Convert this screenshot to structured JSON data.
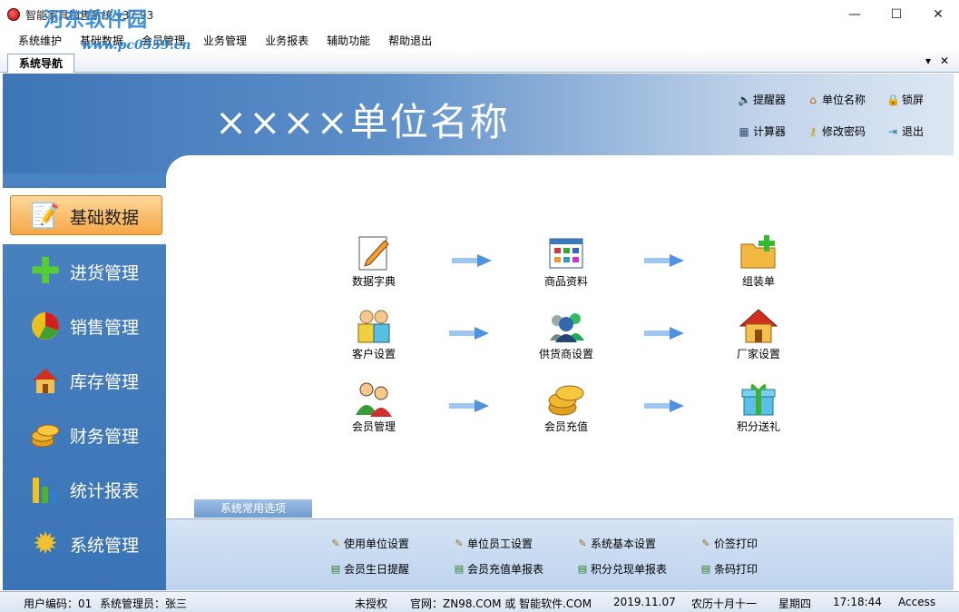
{
  "window": {
    "title": "智能家具销售系统 v37.93",
    "watermark": "河东软件园",
    "watermark_url": "www.pc0359.cn",
    "controls": {
      "minimize": "—",
      "maximize": "☐",
      "close": "✕"
    }
  },
  "menu": [
    "系统维护",
    "基础数据",
    "会员管理",
    "业务管理",
    "业务报表",
    "辅助功能",
    "帮助退出"
  ],
  "tabs": {
    "active": "系统导航",
    "dropdown": "▾",
    "close": "✕"
  },
  "header": {
    "unit_name": "××××单位名称",
    "tools": [
      {
        "label": "提醒器",
        "icon": "speaker-icon"
      },
      {
        "label": "单位名称",
        "icon": "home-icon"
      },
      {
        "label": "锁屏",
        "icon": "lock-icon"
      },
      {
        "label": "计算器",
        "icon": "calculator-icon"
      },
      {
        "label": "修改密码",
        "icon": "key-icon"
      },
      {
        "label": "退出",
        "icon": "exit-icon"
      }
    ]
  },
  "sidebar": {
    "items": [
      {
        "label": "基础数据",
        "icon": "pencil-icon",
        "active": true
      },
      {
        "label": "进货管理",
        "icon": "plus-icon"
      },
      {
        "label": "销售管理",
        "icon": "pie-chart-icon"
      },
      {
        "label": "库存管理",
        "icon": "house-icon"
      },
      {
        "label": "财务管理",
        "icon": "coins-icon"
      },
      {
        "label": "统计报表",
        "icon": "bar-chart-icon"
      },
      {
        "label": "系统管理",
        "icon": "gear-icon"
      }
    ]
  },
  "flow": {
    "rows": [
      [
        {
          "label": "数据字典",
          "icon": "notepad-icon"
        },
        {
          "label": "商品资料",
          "icon": "grid-window-icon"
        },
        {
          "label": "组装单",
          "icon": "folder-add-icon"
        }
      ],
      [
        {
          "label": "客户设置",
          "icon": "users-icon"
        },
        {
          "label": "供货商设置",
          "icon": "group-icon"
        },
        {
          "label": "厂家设置",
          "icon": "house-icon"
        }
      ],
      [
        {
          "label": "会员管理",
          "icon": "members-icon"
        },
        {
          "label": "会员充值",
          "icon": "coins-icon"
        },
        {
          "label": "积分送礼",
          "icon": "gift-icon"
        }
      ]
    ]
  },
  "common": {
    "title": "系统常用选项",
    "options": [
      {
        "label": "使用单位设置",
        "icon": "settings-doc-icon"
      },
      {
        "label": "单位员工设置",
        "icon": "settings-doc-icon"
      },
      {
        "label": "系统基本设置",
        "icon": "settings-doc-icon"
      },
      {
        "label": "价签打印",
        "icon": "settings-doc-icon"
      },
      {
        "label": "会员生日提醒",
        "icon": "report-icon"
      },
      {
        "label": "会员充值单报表",
        "icon": "report-icon"
      },
      {
        "label": "积分兑现单报表",
        "icon": "report-icon"
      },
      {
        "label": "条码打印",
        "icon": "report-icon"
      }
    ]
  },
  "status": {
    "user_code": "用户编码：01",
    "operator": "系统管理员：张三",
    "license": "未授权",
    "website": "官网：ZN98.COM 或 智能软件.COM",
    "date": "2019.11.07",
    "lunar": "农历十月十一",
    "weekday": "星期四",
    "time": "17:18:44",
    "db": "Access"
  }
}
